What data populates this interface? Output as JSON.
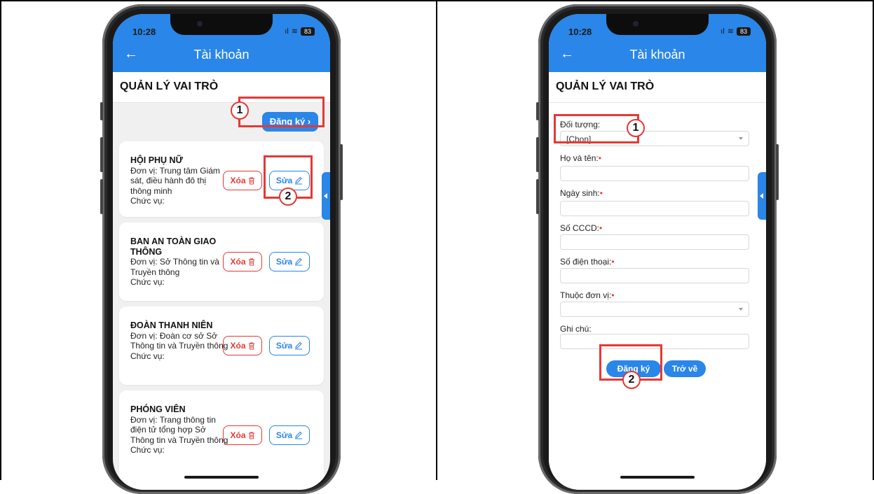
{
  "status": {
    "time": "10:28",
    "signal": "ıl",
    "wifi": "≋",
    "battery": "83"
  },
  "appbar": {
    "title": "Tài khoản",
    "back_icon": "←"
  },
  "page_title": "QUẢN LÝ VAI TRÒ",
  "list": {
    "register_button": "Đăng ký",
    "register_chevron": "›",
    "delete_label": "Xóa",
    "edit_label": "Sửa",
    "items": [
      {
        "name": "HỘI PHỤ NỮ",
        "unit": "Đơn vị: Trung tâm Giám sát, điều hành đô thị thông minh",
        "role": "Chức vụ:"
      },
      {
        "name": "BAN AN TOÀN GIAO THÔNG",
        "unit": "Đơn vị: Sở Thông tin và Truyền thông",
        "role": "Chức vụ:"
      },
      {
        "name": "ĐOÀN THANH NIÊN",
        "unit": "Đơn vị: Đoàn cơ sở Sở Thông tin và Truyền thông",
        "role": "Chức vụ:"
      },
      {
        "name": "PHÓNG VIÊN",
        "unit": "Đơn vị: Trang thông tin điện tử tổng hợp Sở Thông tin và Truyền thông",
        "role": "Chức vụ:"
      }
    ]
  },
  "form": {
    "fields": [
      {
        "label": "Đối tượng:",
        "required": false,
        "value": "[Chọn]",
        "type": "select"
      },
      {
        "label": "Họ và tên:",
        "required": true,
        "value": "",
        "type": "text"
      },
      {
        "label": "Ngày sinh:",
        "required": true,
        "value": "",
        "type": "text"
      },
      {
        "label": "Số CCCD:",
        "required": true,
        "value": "",
        "type": "text"
      },
      {
        "label": "Số điện thoại:",
        "required": true,
        "value": "",
        "type": "text"
      },
      {
        "label": "Thuộc đơn vị:",
        "required": true,
        "value": "",
        "type": "select"
      },
      {
        "label": "Ghi chú:",
        "required": false,
        "value": "",
        "type": "text"
      }
    ],
    "required_mark": "•",
    "submit_button": "Đăng ký",
    "back_button": "Trở về"
  },
  "annotations": {
    "one": "1",
    "two": "2"
  },
  "colors": {
    "primary": "#2a86e8",
    "danger": "#e53935",
    "highlight": "#e53935"
  },
  "icons": {
    "delete": "trash-icon",
    "edit": "pencil-icon",
    "back": "arrow-left-icon"
  }
}
